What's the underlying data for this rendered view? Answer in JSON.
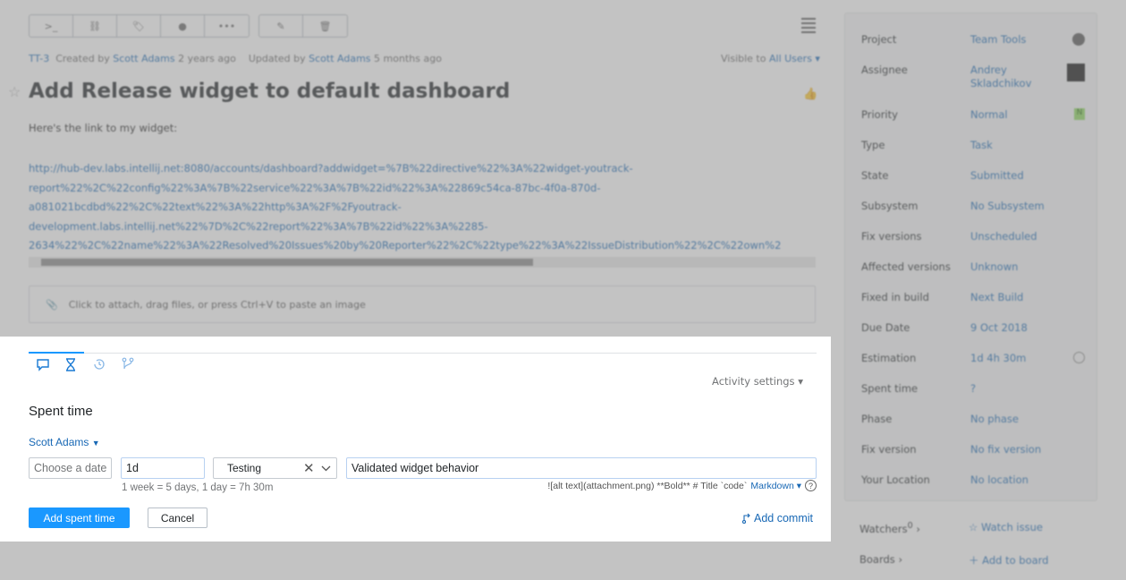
{
  "issue": {
    "id": "TT-3",
    "created_by_prefix": "Created by",
    "creator": "Scott Adams",
    "created_ago": "2 years ago",
    "updated_prefix": "Updated by",
    "updater": "Scott Adams",
    "updated_ago": "5 months ago",
    "visible_prefix": "Visible to",
    "visible_to": "All Users",
    "title": "Add Release widget to default dashboard",
    "description": "Here's the link to my widget:",
    "url_lines": [
      "http://hub-dev.labs.intellij.net:8080/accounts/dashboard?addwidget=%7B%22directive%22%3A%22widget-youtrack-",
      "report%22%2C%22config%22%3A%7B%22service%22%3A%7B%22id%22%3A%22869c54ca-87bc-4f0a-870d-",
      "a081021bcdbd%22%2C%22text%22%3A%22http%3A%2F%2Fyoutrack-",
      "development.labs.intellij.net%22%7D%2C%22report%22%3A%7B%22id%22%3A%2285-",
      "2634%22%2C%22name%22%3A%22Resolved%20Issues%20by%20Reporter%22%2C%22type%22%3A%22IssueDistribution%22%2C%22own%2"
    ],
    "attach_hint": "Click to attach, drag files, or press Ctrl+V to paste an image"
  },
  "sidebar": {
    "fields": [
      {
        "key": "Project",
        "value": "Team Tools"
      },
      {
        "key": "Assignee",
        "value": "Andrey Skladchikov"
      },
      {
        "key": "Priority",
        "value": "Normal"
      },
      {
        "key": "Type",
        "value": "Task"
      },
      {
        "key": "State",
        "value": "Submitted"
      },
      {
        "key": "Subsystem",
        "value": "No Subsystem"
      },
      {
        "key": "Fix versions",
        "value": "Unscheduled"
      },
      {
        "key": "Affected versions",
        "value": "Unknown"
      },
      {
        "key": "Fixed in build",
        "value": "Next Build"
      },
      {
        "key": "Due Date",
        "value": "9 Oct 2018"
      },
      {
        "key": "Estimation",
        "value": "1d 4h 30m"
      },
      {
        "key": "Spent time",
        "value": "?"
      },
      {
        "key": "Phase",
        "value": "No phase"
      },
      {
        "key": "Fix version",
        "value": "No fix version"
      },
      {
        "key": "Your Location",
        "value": "No location"
      }
    ],
    "priority_badge": "N",
    "watchers_label": "Watchers",
    "watchers_count": "0",
    "watch_issue": "Watch issue",
    "boards_label": "Boards",
    "add_to_board": "Add to board"
  },
  "activity": {
    "settings_label": "Activity settings",
    "section_title": "Spent time",
    "author": "Scott Adams",
    "date_placeholder": "Choose a date",
    "duration_value": "1d",
    "work_type_value": "Testing",
    "comment_value": "Validated widget behavior",
    "duration_hint": "1 week = 5 days, 1 day = 7h 30m",
    "markdown_hint": "![alt text](attachment.png) **Bold** # Title `code`",
    "markdown_label": "Markdown",
    "help_glyph": "?",
    "add_button": "Add spent time",
    "cancel_button": "Cancel",
    "add_commit": "Add commit"
  }
}
